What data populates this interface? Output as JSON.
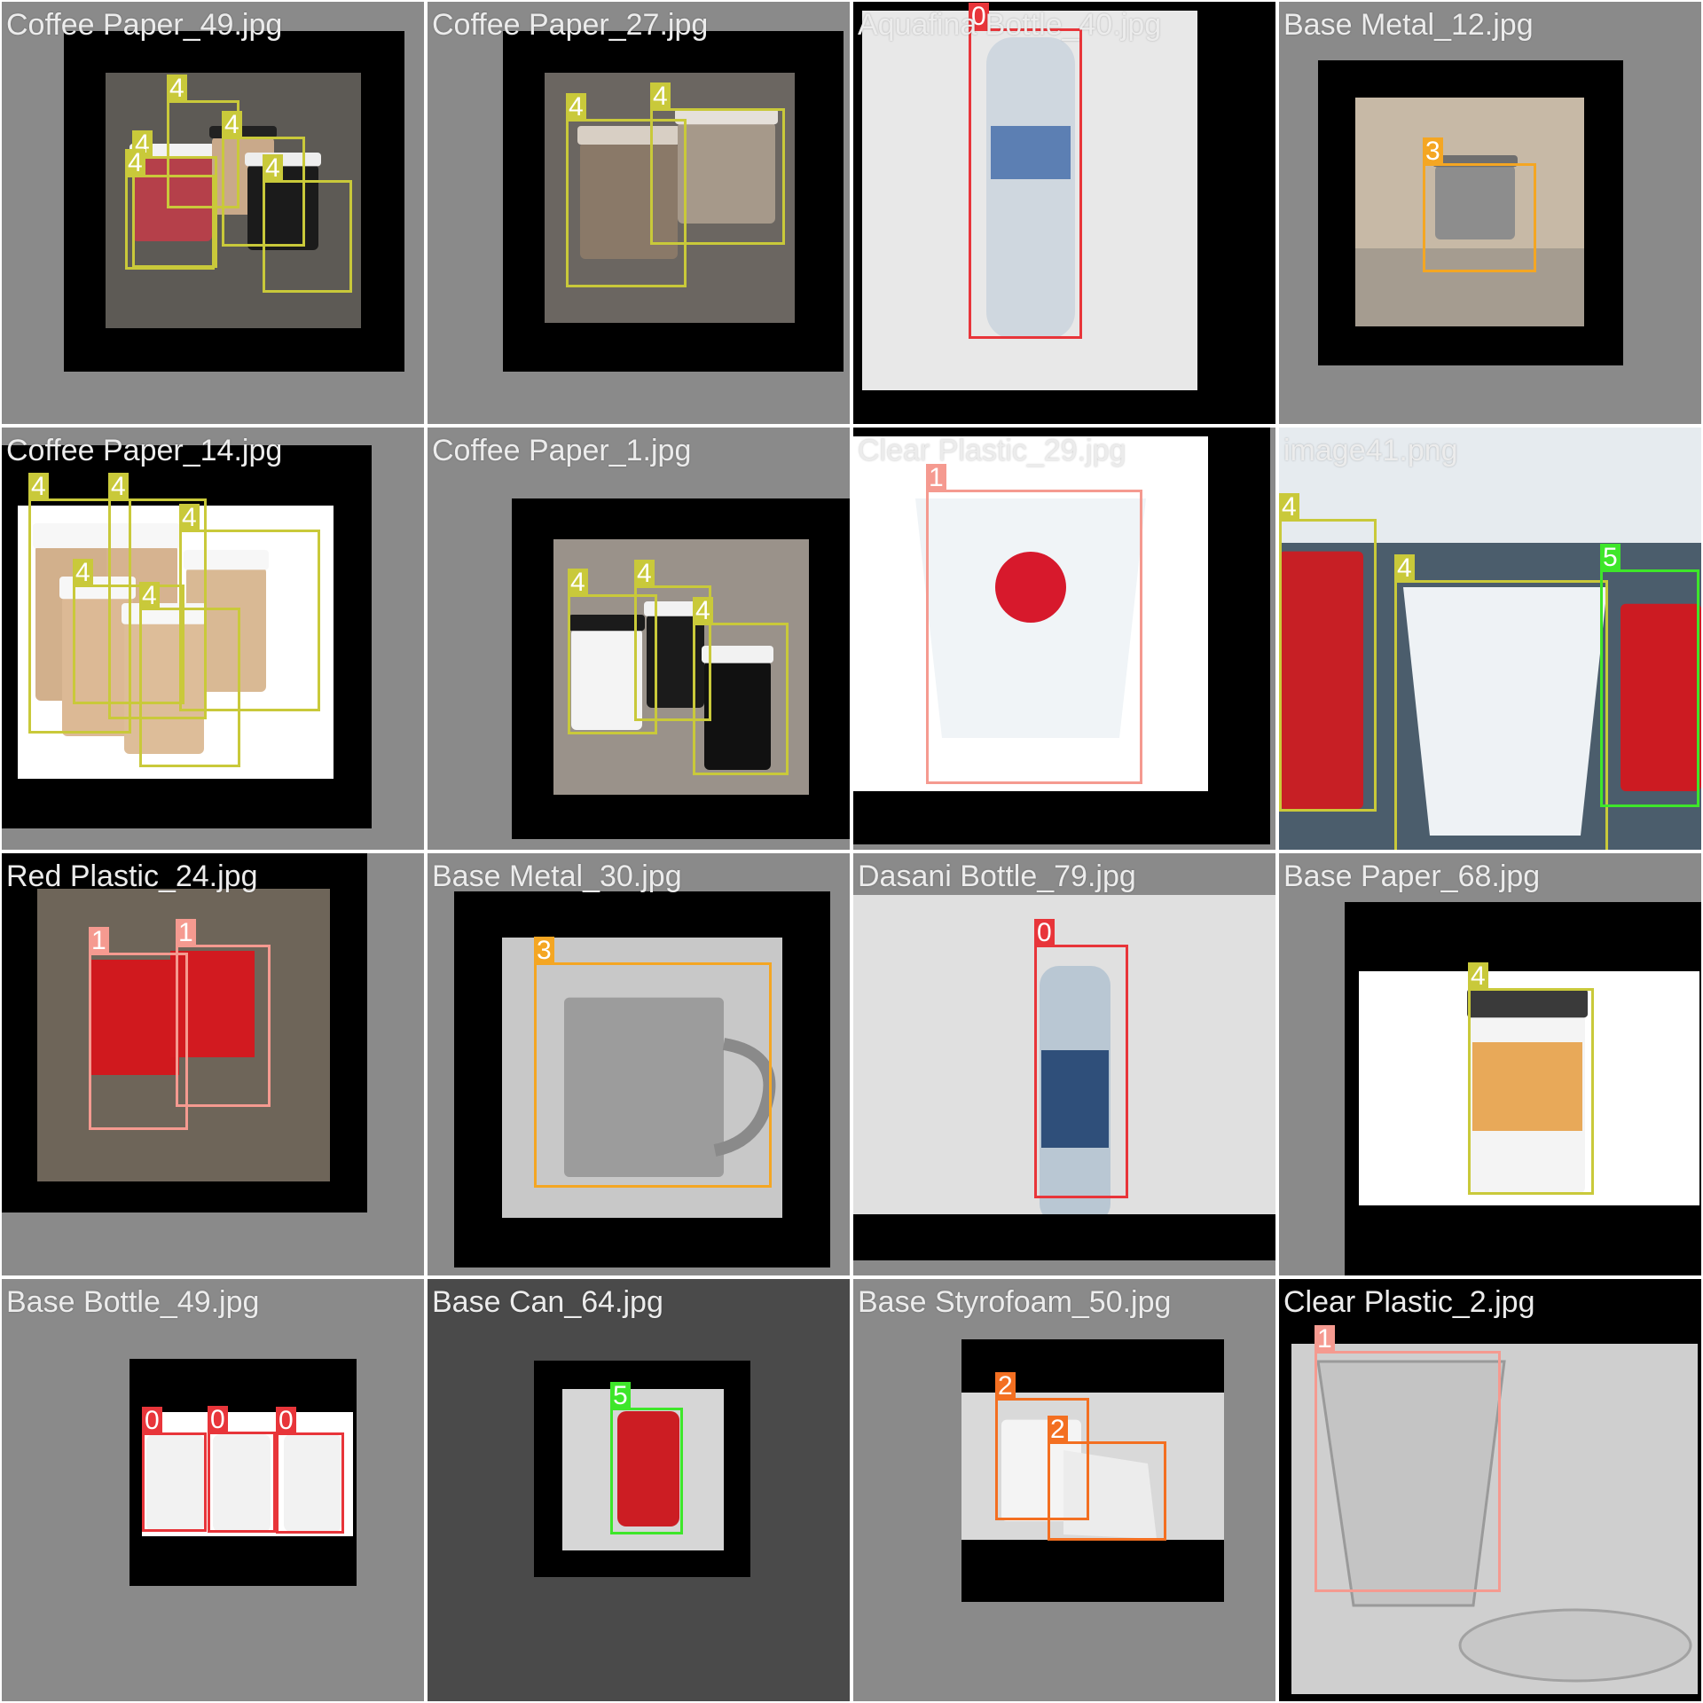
{
  "classes": {
    "0": {
      "color": "#e8353a"
    },
    "1": {
      "color": "#f59a90"
    },
    "2": {
      "color": "#f36f21"
    },
    "3": {
      "color": "#f4a623"
    },
    "4": {
      "color": "#c9c93a"
    },
    "5": {
      "color": "#3ee62a"
    }
  },
  "tiles": [
    {
      "filename": "Coffee Paper_49.jpg",
      "objects": [
        {
          "cls": "4",
          "label": "4"
        },
        {
          "cls": "4",
          "label": "4"
        },
        {
          "cls": "4",
          "label": "4"
        },
        {
          "cls": "4",
          "label": "4"
        },
        {
          "cls": "4",
          "label": "4"
        }
      ]
    },
    {
      "filename": "Coffee Paper_27.jpg",
      "objects": [
        {
          "cls": "4",
          "label": "4"
        },
        {
          "cls": "4",
          "label": "4"
        }
      ]
    },
    {
      "filename": "Aquafina Bottle_40.jpg",
      "objects": [
        {
          "cls": "0",
          "label": "0"
        }
      ]
    },
    {
      "filename": "Base Metal_12.jpg",
      "objects": [
        {
          "cls": "3",
          "label": "3"
        }
      ]
    },
    {
      "filename": "Coffee Paper_14.jpg",
      "objects": [
        {
          "cls": "4",
          "label": "4"
        },
        {
          "cls": "4",
          "label": "4"
        },
        {
          "cls": "4",
          "label": "4"
        },
        {
          "cls": "4",
          "label": "4"
        },
        {
          "cls": "4",
          "label": "4"
        }
      ]
    },
    {
      "filename": "Coffee Paper_1.jpg",
      "objects": [
        {
          "cls": "4",
          "label": "4"
        },
        {
          "cls": "4",
          "label": "4"
        },
        {
          "cls": "4",
          "label": "4"
        }
      ]
    },
    {
      "filename": "Clear Plastic_29.jpg",
      "objects": [
        {
          "cls": "1",
          "label": "1"
        }
      ]
    },
    {
      "filename": "image41.png",
      "objects": [
        {
          "cls": "4",
          "label": "4"
        },
        {
          "cls": "4",
          "label": "4"
        },
        {
          "cls": "5",
          "label": "5"
        }
      ]
    },
    {
      "filename": "Red Plastic_24.jpg",
      "objects": [
        {
          "cls": "1",
          "label": "1"
        },
        {
          "cls": "1",
          "label": "1"
        }
      ]
    },
    {
      "filename": "Base Metal_30.jpg",
      "objects": [
        {
          "cls": "3",
          "label": "3"
        }
      ]
    },
    {
      "filename": "Dasani Bottle_79.jpg",
      "objects": [
        {
          "cls": "0",
          "label": "0"
        }
      ]
    },
    {
      "filename": "Base Paper_68.jpg",
      "objects": [
        {
          "cls": "4",
          "label": "4"
        }
      ]
    },
    {
      "filename": "Base Bottle_49.jpg",
      "objects": [
        {
          "cls": "0",
          "label": "0"
        },
        {
          "cls": "0",
          "label": "0"
        },
        {
          "cls": "0",
          "label": "0"
        }
      ]
    },
    {
      "filename": "Base Can_64.jpg",
      "objects": [
        {
          "cls": "5",
          "label": "5"
        }
      ]
    },
    {
      "filename": "Base Styrofoam_50.jpg",
      "objects": [
        {
          "cls": "2",
          "label": "2"
        },
        {
          "cls": "2",
          "label": "2"
        }
      ]
    },
    {
      "filename": "Clear Plastic_2.jpg",
      "objects": [
        {
          "cls": "1",
          "label": "1"
        }
      ]
    }
  ]
}
